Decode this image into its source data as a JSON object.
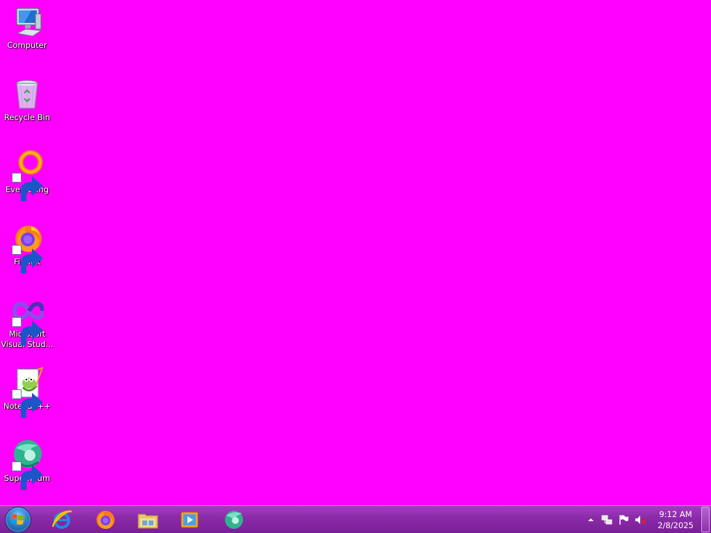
{
  "desktop": {
    "background": "#ff00ff",
    "icons": [
      {
        "name": "computer",
        "label": "Computer",
        "icon": "computer-icon",
        "shortcut": false
      },
      {
        "name": "recycle-bin",
        "label": "Recycle Bin",
        "icon": "recycle-bin-icon",
        "shortcut": false
      },
      {
        "name": "everything",
        "label": "Everything",
        "icon": "everything-icon",
        "shortcut": true
      },
      {
        "name": "firefox",
        "label": "Firefox",
        "icon": "firefox-icon",
        "shortcut": true
      },
      {
        "name": "visual-studio",
        "label": "Microsoft\nVisual Stud...",
        "icon": "visual-studio-icon",
        "shortcut": true
      },
      {
        "name": "notepad-plus-plus",
        "label": "Notepad++",
        "icon": "notepad-plus-plus-icon",
        "shortcut": true
      },
      {
        "name": "supermium",
        "label": "Supermium",
        "icon": "supermium-icon",
        "shortcut": true
      }
    ]
  },
  "taskbar": {
    "color": "#8a2aa8",
    "start": {
      "icon": "windows-start-icon"
    },
    "pinned": [
      {
        "name": "internet-explorer",
        "icon": "internet-explorer-icon"
      },
      {
        "name": "firefox",
        "icon": "firefox-icon"
      },
      {
        "name": "file-explorer",
        "icon": "file-explorer-icon"
      },
      {
        "name": "media-player",
        "icon": "media-player-icon"
      },
      {
        "name": "supermium",
        "icon": "supermium-icon"
      }
    ],
    "tray": {
      "icons": [
        "show-hidden-icons-icon",
        "network-icon",
        "action-center-flag-icon",
        "volume-muted-icon"
      ],
      "time": "9:12 AM",
      "date": "2/8/2025"
    }
  }
}
